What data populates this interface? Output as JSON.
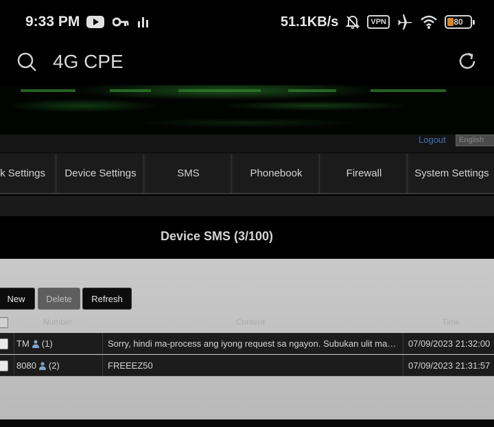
{
  "status_bar": {
    "time": "9:33 PM",
    "speed": "51.1KB/s",
    "vpn_label": "VPN",
    "battery_level": "80",
    "icons": [
      "youtube-icon",
      "key-icon",
      "signal-bars-icon",
      "bell-muted-icon",
      "vpn-icon",
      "airplane-icon",
      "wifi-icon",
      "battery-icon"
    ]
  },
  "app_bar": {
    "title": "4G CPE",
    "icons": [
      "search-icon",
      "refresh-icon"
    ]
  },
  "top_bar": {
    "logout": "Logout",
    "language": "English"
  },
  "nav": {
    "items": [
      {
        "label": "k Settings"
      },
      {
        "label": "Device Settings"
      },
      {
        "label": "SMS"
      },
      {
        "label": "Phonebook"
      },
      {
        "label": "Firewall"
      },
      {
        "label": "System Settings"
      }
    ]
  },
  "page": {
    "title": "Device SMS (3/100)"
  },
  "toolbar": {
    "new_label": "New",
    "delete_label": "Delete",
    "refresh_label": "Refresh"
  },
  "table": {
    "headers": [
      "Number",
      "Content",
      "Time"
    ],
    "rows": [
      {
        "number": "TM",
        "count": "(1)",
        "content": "Sorry, hindi ma-process ang iyong request sa ngayon. Subukan ulit mamaya.",
        "time": "07/09/2023 21:32:00"
      },
      {
        "number": "8080",
        "count": "(2)",
        "content": "FREEEZ50",
        "time": "07/09/2023 21:31:57"
      }
    ]
  },
  "colors": {
    "link": "#3e74b8",
    "battery_fill": "#d8862a",
    "banner_green": "#2f7a2c"
  }
}
